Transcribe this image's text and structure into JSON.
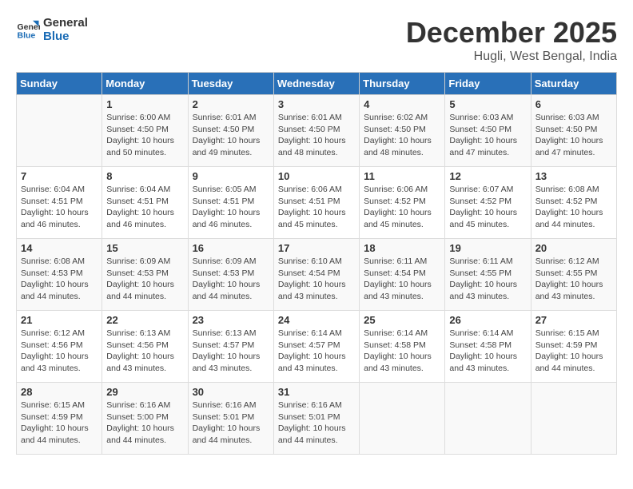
{
  "header": {
    "logo_line1": "General",
    "logo_line2": "Blue",
    "month": "December 2025",
    "location": "Hugli, West Bengal, India"
  },
  "weekdays": [
    "Sunday",
    "Monday",
    "Tuesday",
    "Wednesday",
    "Thursday",
    "Friday",
    "Saturday"
  ],
  "weeks": [
    [
      {
        "num": "",
        "info": ""
      },
      {
        "num": "1",
        "info": "Sunrise: 6:00 AM\nSunset: 4:50 PM\nDaylight: 10 hours\nand 50 minutes."
      },
      {
        "num": "2",
        "info": "Sunrise: 6:01 AM\nSunset: 4:50 PM\nDaylight: 10 hours\nand 49 minutes."
      },
      {
        "num": "3",
        "info": "Sunrise: 6:01 AM\nSunset: 4:50 PM\nDaylight: 10 hours\nand 48 minutes."
      },
      {
        "num": "4",
        "info": "Sunrise: 6:02 AM\nSunset: 4:50 PM\nDaylight: 10 hours\nand 48 minutes."
      },
      {
        "num": "5",
        "info": "Sunrise: 6:03 AM\nSunset: 4:50 PM\nDaylight: 10 hours\nand 47 minutes."
      },
      {
        "num": "6",
        "info": "Sunrise: 6:03 AM\nSunset: 4:50 PM\nDaylight: 10 hours\nand 47 minutes."
      }
    ],
    [
      {
        "num": "7",
        "info": "Sunrise: 6:04 AM\nSunset: 4:51 PM\nDaylight: 10 hours\nand 46 minutes."
      },
      {
        "num": "8",
        "info": "Sunrise: 6:04 AM\nSunset: 4:51 PM\nDaylight: 10 hours\nand 46 minutes."
      },
      {
        "num": "9",
        "info": "Sunrise: 6:05 AM\nSunset: 4:51 PM\nDaylight: 10 hours\nand 46 minutes."
      },
      {
        "num": "10",
        "info": "Sunrise: 6:06 AM\nSunset: 4:51 PM\nDaylight: 10 hours\nand 45 minutes."
      },
      {
        "num": "11",
        "info": "Sunrise: 6:06 AM\nSunset: 4:52 PM\nDaylight: 10 hours\nand 45 minutes."
      },
      {
        "num": "12",
        "info": "Sunrise: 6:07 AM\nSunset: 4:52 PM\nDaylight: 10 hours\nand 45 minutes."
      },
      {
        "num": "13",
        "info": "Sunrise: 6:08 AM\nSunset: 4:52 PM\nDaylight: 10 hours\nand 44 minutes."
      }
    ],
    [
      {
        "num": "14",
        "info": "Sunrise: 6:08 AM\nSunset: 4:53 PM\nDaylight: 10 hours\nand 44 minutes."
      },
      {
        "num": "15",
        "info": "Sunrise: 6:09 AM\nSunset: 4:53 PM\nDaylight: 10 hours\nand 44 minutes."
      },
      {
        "num": "16",
        "info": "Sunrise: 6:09 AM\nSunset: 4:53 PM\nDaylight: 10 hours\nand 44 minutes."
      },
      {
        "num": "17",
        "info": "Sunrise: 6:10 AM\nSunset: 4:54 PM\nDaylight: 10 hours\nand 43 minutes."
      },
      {
        "num": "18",
        "info": "Sunrise: 6:11 AM\nSunset: 4:54 PM\nDaylight: 10 hours\nand 43 minutes."
      },
      {
        "num": "19",
        "info": "Sunrise: 6:11 AM\nSunset: 4:55 PM\nDaylight: 10 hours\nand 43 minutes."
      },
      {
        "num": "20",
        "info": "Sunrise: 6:12 AM\nSunset: 4:55 PM\nDaylight: 10 hours\nand 43 minutes."
      }
    ],
    [
      {
        "num": "21",
        "info": "Sunrise: 6:12 AM\nSunset: 4:56 PM\nDaylight: 10 hours\nand 43 minutes."
      },
      {
        "num": "22",
        "info": "Sunrise: 6:13 AM\nSunset: 4:56 PM\nDaylight: 10 hours\nand 43 minutes."
      },
      {
        "num": "23",
        "info": "Sunrise: 6:13 AM\nSunset: 4:57 PM\nDaylight: 10 hours\nand 43 minutes."
      },
      {
        "num": "24",
        "info": "Sunrise: 6:14 AM\nSunset: 4:57 PM\nDaylight: 10 hours\nand 43 minutes."
      },
      {
        "num": "25",
        "info": "Sunrise: 6:14 AM\nSunset: 4:58 PM\nDaylight: 10 hours\nand 43 minutes."
      },
      {
        "num": "26",
        "info": "Sunrise: 6:14 AM\nSunset: 4:58 PM\nDaylight: 10 hours\nand 43 minutes."
      },
      {
        "num": "27",
        "info": "Sunrise: 6:15 AM\nSunset: 4:59 PM\nDaylight: 10 hours\nand 44 minutes."
      }
    ],
    [
      {
        "num": "28",
        "info": "Sunrise: 6:15 AM\nSunset: 4:59 PM\nDaylight: 10 hours\nand 44 minutes."
      },
      {
        "num": "29",
        "info": "Sunrise: 6:16 AM\nSunset: 5:00 PM\nDaylight: 10 hours\nand 44 minutes."
      },
      {
        "num": "30",
        "info": "Sunrise: 6:16 AM\nSunset: 5:01 PM\nDaylight: 10 hours\nand 44 minutes."
      },
      {
        "num": "31",
        "info": "Sunrise: 6:16 AM\nSunset: 5:01 PM\nDaylight: 10 hours\nand 44 minutes."
      },
      {
        "num": "",
        "info": ""
      },
      {
        "num": "",
        "info": ""
      },
      {
        "num": "",
        "info": ""
      }
    ]
  ]
}
